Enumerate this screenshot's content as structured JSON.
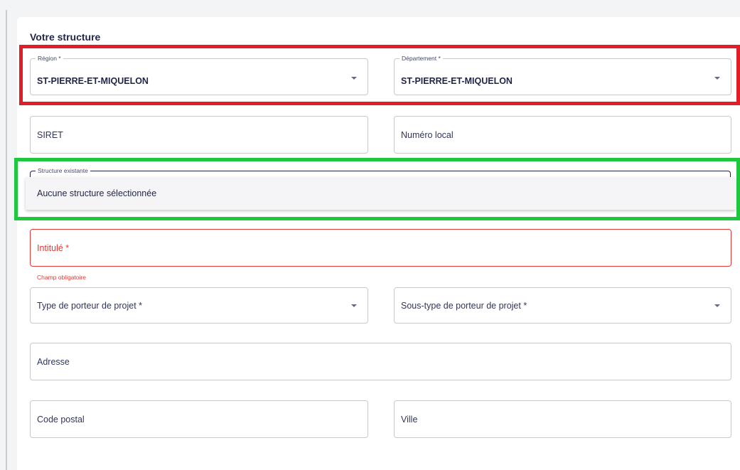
{
  "form": {
    "section_title": "Votre structure",
    "region": {
      "label": "Région *",
      "value": "ST-PIERRE-ET-MIQUELON"
    },
    "departement": {
      "label": "Département *",
      "value": "ST-PIERRE-ET-MIQUELON"
    },
    "siret": {
      "placeholder": "SIRET"
    },
    "numero_local": {
      "placeholder": "Numéro local"
    },
    "structure_existante": {
      "label": "Structure existante",
      "options": [
        "Aucune structure sélectionnée"
      ]
    },
    "intitule": {
      "placeholder": "Intitulé *",
      "error": "Champ obligatoire"
    },
    "type_porteur": {
      "placeholder": "Type de porteur de projet *"
    },
    "sous_type_porteur": {
      "placeholder": "Sous-type de porteur de projet *"
    },
    "adresse": {
      "placeholder": "Adresse"
    },
    "code_postal": {
      "placeholder": "Code postal"
    },
    "ville": {
      "placeholder": "Ville"
    }
  },
  "colors": {
    "highlight_red": "#e11d25",
    "highlight_green": "#1ec73d",
    "error": "#e53935",
    "text": "#1f2547"
  }
}
